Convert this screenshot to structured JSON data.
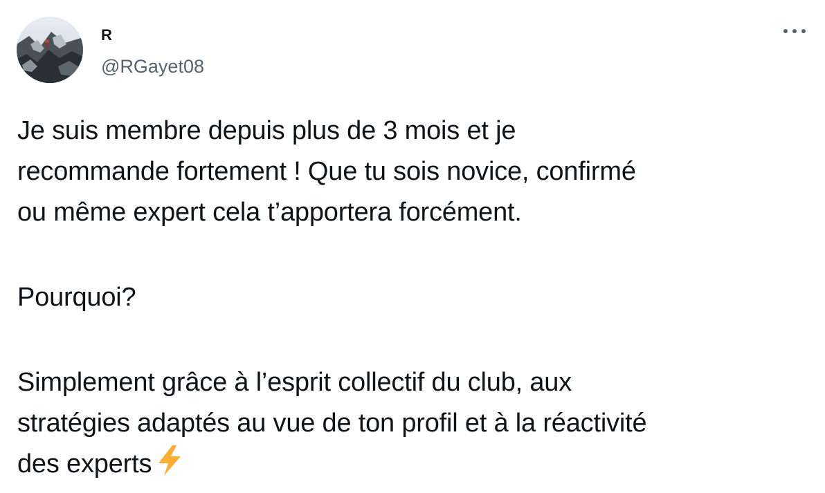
{
  "tweet": {
    "author_name": "R",
    "author_handle": "@RGayet08",
    "more_icon": "more-horizontal-icon",
    "lines": [
      "Je suis membre depuis plus de 3 mois et je",
      "recommande fortement ! Que tu sois novice, confirmé",
      "ou même expert cela t’apportera forcément.",
      "Pourquoi?",
      "Simplement grâce à l’esprit collectif du club, aux",
      "stratégies adaptés au vue de ton profil et à la réactivité",
      "des experts"
    ],
    "emoji": "high-voltage-icon"
  },
  "colors": {
    "text": "#0f1419",
    "secondary": "#536471",
    "bolt": "#ffac33"
  }
}
